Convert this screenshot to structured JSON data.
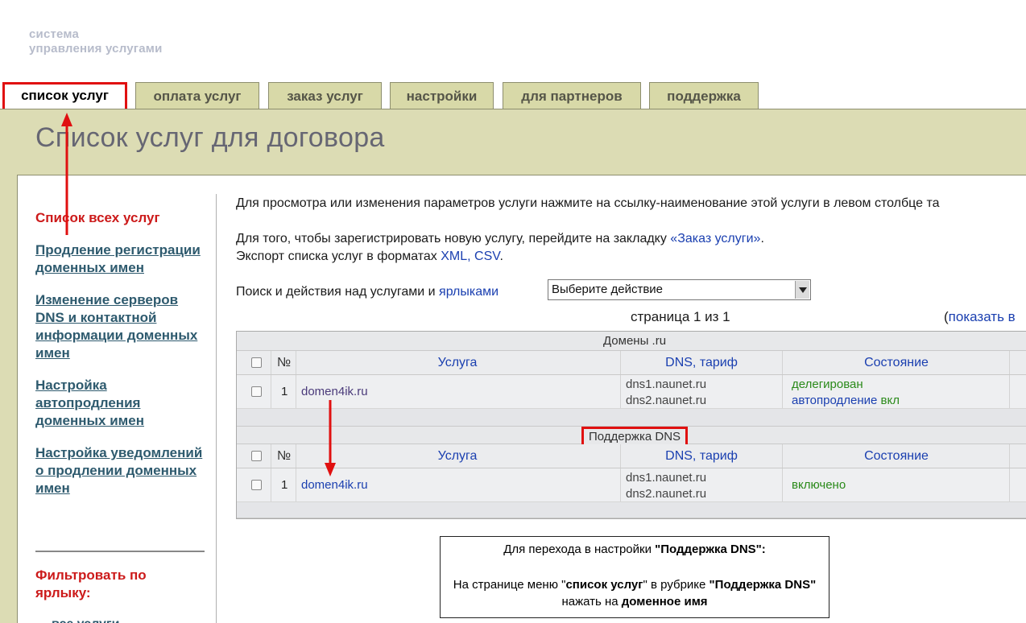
{
  "logo": {
    "line1": "система",
    "line2": "управления услугами"
  },
  "tabs": [
    {
      "label": "список услуг"
    },
    {
      "label": "оплата услуг"
    },
    {
      "label": "заказ услуг"
    },
    {
      "label": "настройки"
    },
    {
      "label": "для партнеров"
    },
    {
      "label": "поддержка"
    }
  ],
  "page_title": "Список услуг для договора",
  "sidebar": {
    "heading": "Список всех услуг",
    "links": [
      "Продление регистрации доменных имен",
      "Изменение серверов DNS и контактной информации доменных имен",
      "Настройка автопродления доменных имен",
      "Настройка уведомлений о продлении доменных имен"
    ],
    "filter_heading": "Фильтровать по ярлыку:",
    "filter_item": "все услуги"
  },
  "main": {
    "intro": "Для просмотра или изменения параметров услуги нажмите на ссылку-наименование этой услуги в левом столбце та",
    "register_text": "Для того, чтобы зарегистрировать новую услугу, перейдите на закладку ",
    "register_link": "«Заказ услуги»",
    "register_end": ".",
    "export_text": "Экспорт списка услуг в форматах ",
    "export_xml": "XML",
    "export_sep": ", ",
    "export_csv": "CSV",
    "export_end": ".",
    "search_text": "Поиск и действия над услугами и ",
    "search_link": "ярлыками",
    "select_value": "Выберите действие",
    "pagination": "страница 1 из 1",
    "show_all_paren": "(",
    "show_all_link": "показать в"
  },
  "table": {
    "columns": {
      "num": "№",
      "service": "Услуга",
      "dns": "DNS, тариф",
      "state": "Состояние"
    },
    "groups": [
      {
        "title": "Домены .ru",
        "rows": [
          {
            "num": "1",
            "service": "domen4ik.ru",
            "dns1": "dns1.naunet.ru",
            "dns2": "dns2.naunet.ru",
            "state1": "делегирован",
            "state2_link": "автопродление",
            "state2_val": "вкл"
          }
        ]
      },
      {
        "title": "Поддержка DNS",
        "rows": [
          {
            "num": "1",
            "service": "domen4ik.ru",
            "dns1": "dns1.naunet.ru",
            "dns2": "dns2.naunet.ru",
            "state1": "включено"
          }
        ]
      }
    ]
  },
  "note": {
    "line1_a": "Для перехода в настройки ",
    "line1_b": "\"Поддержка DNS\":",
    "line2_a": "На странице меню \"",
    "line2_b": "список услуг",
    "line2_c": "\" в рубрике ",
    "line2_d": "\"Поддержка DNS\"",
    "line3_a": "нажать на ",
    "line3_b": "доменное имя"
  },
  "colors": {
    "tab_bg": "#d8d9a8",
    "band_bg": "#dcdcb4",
    "highlight": "#e01010",
    "link": "#1a3fb0",
    "state_green": "#2a8a1a"
  }
}
